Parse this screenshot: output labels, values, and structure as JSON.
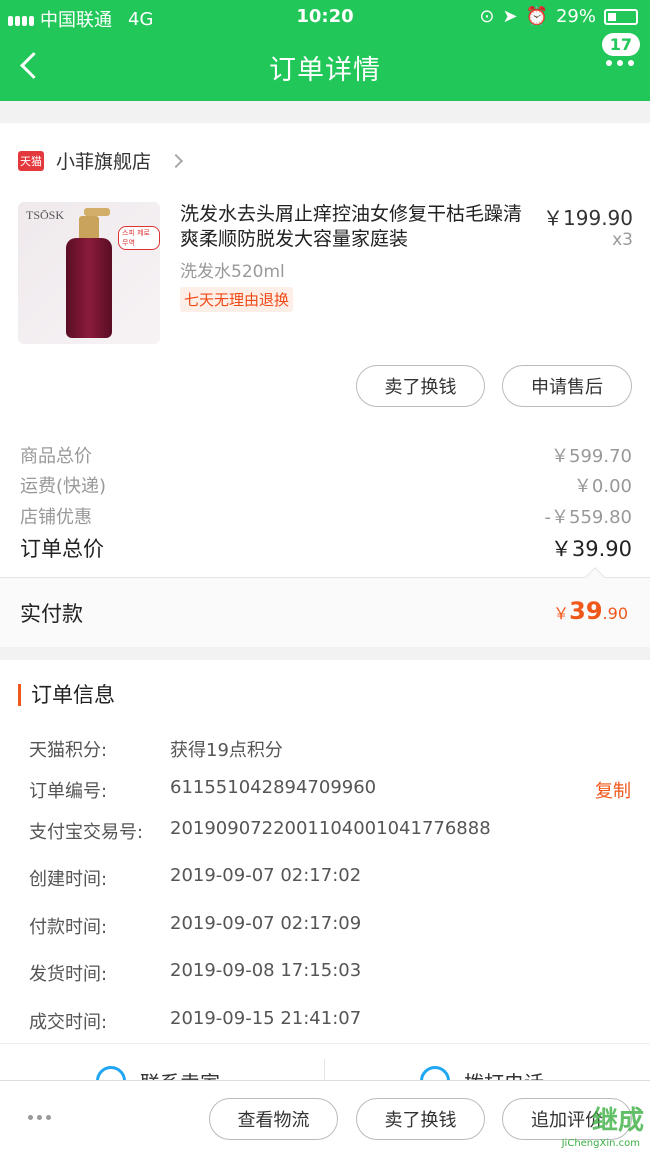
{
  "status_bar": {
    "carrier": "中国联通",
    "network": "4G",
    "time": "10:20",
    "battery": "29%"
  },
  "header": {
    "title": "订单详情",
    "badge": "17"
  },
  "shop": {
    "logo_text": "天猫",
    "name": "小菲旗舰店"
  },
  "product": {
    "brand": "TSŌSK",
    "name": "洗发水去头屑止痒控油女修复干枯毛躁清爽柔顺防脱发大容量家庭装",
    "price": "￥199.90",
    "qty": "x3",
    "spec": "洗发水520ml",
    "tag": "七天无理由退换",
    "bottle_label": "스피 제로 무역"
  },
  "actions": {
    "sell": "卖了换钱",
    "after_sale": "申请售后"
  },
  "summary": [
    {
      "label": "商品总价",
      "value": "￥599.70"
    },
    {
      "label": "运费(快递)",
      "value": "￥0.00"
    },
    {
      "label": "店铺优惠",
      "value": "-￥559.80"
    }
  ],
  "order_total": {
    "label": "订单总价",
    "value": "￥39.90"
  },
  "paid": {
    "label": "实付款",
    "currency": "￥",
    "integer": "39",
    "decimal": ".90"
  },
  "info": {
    "title": "订单信息",
    "copy_label": "复制",
    "rows": [
      {
        "key": "天猫积分:",
        "value": "获得19点积分"
      },
      {
        "key": "订单编号:",
        "value": "611551042894709960"
      },
      {
        "key": "支付宝交易号:",
        "value": "2019090722001104001041776888"
      },
      {
        "key": "创建时间:",
        "value": "2019-09-07 02:17:02"
      },
      {
        "key": "付款时间:",
        "value": "2019-09-07 02:17:09"
      },
      {
        "key": "发货时间:",
        "value": "2019-09-08 17:15:03"
      },
      {
        "key": "成交时间:",
        "value": "2019-09-15 21:41:07"
      }
    ]
  },
  "contact": {
    "seller": "联系卖家",
    "phone": "拨打电话"
  },
  "bottom_bar": {
    "logistics": "查看物流",
    "sell": "卖了换钱",
    "review": "追加评价"
  },
  "watermark": {
    "text": "继成",
    "url": "JiChengXin.com"
  },
  "colors": {
    "header_green": "#21c759",
    "accent_orange": "#f0571a",
    "tmall_red": "#e4393c"
  }
}
